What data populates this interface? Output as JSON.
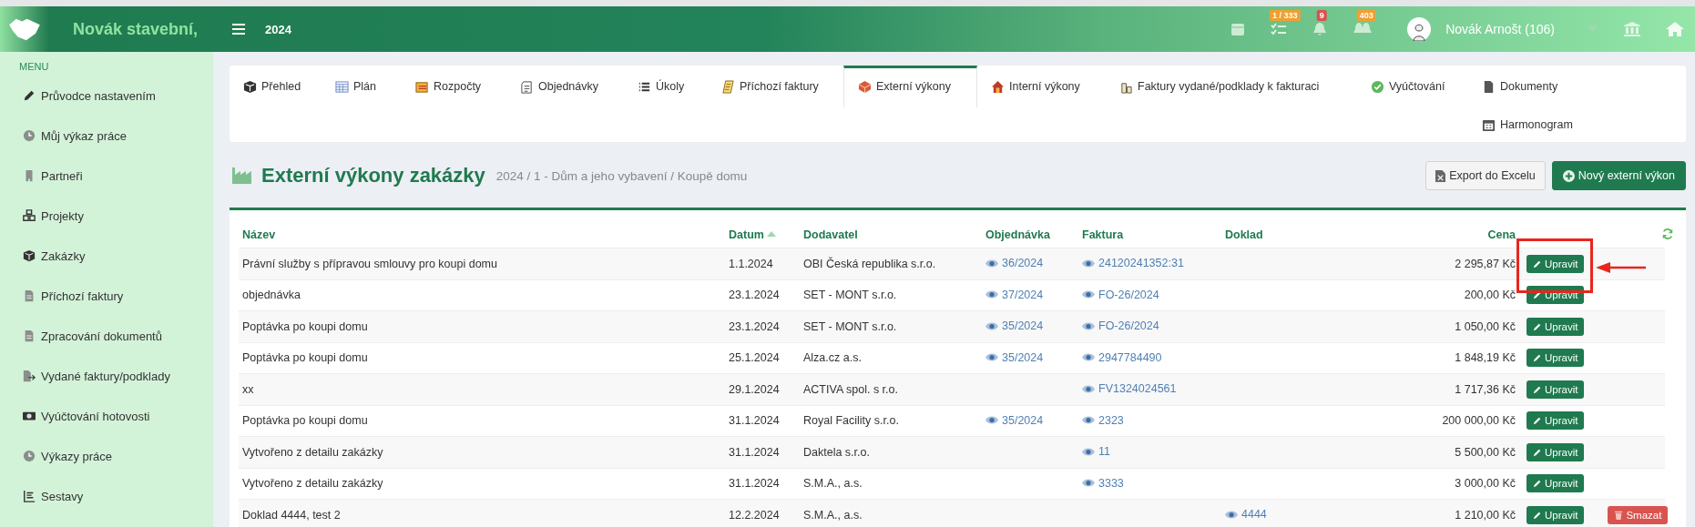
{
  "header": {
    "brand": "Novák stavební,",
    "year": "2024",
    "badges": [
      {
        "text": "1 / 333",
        "color": "#f0a030"
      },
      {
        "text": "9",
        "color": "#d9534f"
      },
      {
        "text": "403",
        "color": "#f0a030"
      }
    ],
    "user": "Novák Arnošt (106)"
  },
  "sidebar": {
    "heading": "MENU",
    "items": [
      {
        "label": "Průvodce nastavením"
      },
      {
        "label": "Můj výkaz práce"
      },
      {
        "label": "Partneři"
      },
      {
        "label": "Projekty"
      },
      {
        "label": "Zakázky"
      },
      {
        "label": "Příchozí faktury"
      },
      {
        "label": "Zpracování dokumentů"
      },
      {
        "label": "Vydané faktury/podklady"
      },
      {
        "label": "Vyúčtování hotovosti"
      },
      {
        "label": "Výkazy práce"
      },
      {
        "label": "Sestavy"
      }
    ]
  },
  "tabs": [
    {
      "label": "Přehled",
      "selected": false
    },
    {
      "label": "Plán",
      "selected": false
    },
    {
      "label": "Rozpočty",
      "selected": false
    },
    {
      "label": "Objednávky",
      "selected": false
    },
    {
      "label": "Úkoly",
      "selected": false
    },
    {
      "label": "Příchozí faktury",
      "selected": false
    },
    {
      "label": "Externí výkony",
      "selected": true
    },
    {
      "label": "Interní výkony",
      "selected": false
    },
    {
      "label": "Faktury vydané/podklady k fakturaci",
      "selected": false
    },
    {
      "label": "Vyúčtování",
      "selected": false
    },
    {
      "label": "Dokumenty",
      "selected": false
    },
    {
      "label": "Harmonogram",
      "selected": false
    }
  ],
  "page": {
    "title": "Externí výkony zakázky",
    "breadcrumb": "2024 / 1 - Dům a jeho vybavení / Koupě domu",
    "buttons": [
      {
        "label": "Export do Excelu",
        "kind": "export"
      },
      {
        "label": "Nový externí výkon",
        "kind": "add"
      }
    ]
  },
  "table": {
    "columns": [
      {
        "label": "Název",
        "sorted": false
      },
      {
        "label": "Datum",
        "sorted": true
      },
      {
        "label": "Dodavatel",
        "sorted": false
      },
      {
        "label": "Objednávka",
        "sorted": false
      },
      {
        "label": "Faktura",
        "sorted": false
      },
      {
        "label": "Doklad",
        "sorted": false
      },
      {
        "label": "Cena",
        "sorted": false
      }
    ],
    "rows": [
      {
        "name": "Právní služby s přípravou smlouvy pro koupi domu",
        "date": "1.1.2024",
        "supplier": "OBI Česká republika s.r.o.",
        "order": "36/2024",
        "invoice": "24120241352:31",
        "price": "2 295,87 Kč",
        "actions": [
          {
            "label": "Upravit",
            "kind": "edit"
          }
        ]
      },
      {
        "name": "objednávka",
        "date": "23.1.2024",
        "supplier": "SET - MONT s.r.o.",
        "order": "37/2024",
        "invoice": "FO-26/2024",
        "price": "200,00 Kč",
        "actions": [
          {
            "label": "Upravit",
            "kind": "edit"
          }
        ]
      },
      {
        "name": "Poptávka po koupi domu",
        "date": "23.1.2024",
        "supplier": "SET - MONT s.r.o.",
        "order": "35/2024",
        "invoice": "FO-26/2024",
        "price": "1 050,00 Kč",
        "actions": [
          {
            "label": "Upravit",
            "kind": "edit"
          }
        ]
      },
      {
        "name": "Poptávka po koupi domu",
        "date": "25.1.2024",
        "supplier": "Alza.cz a.s.",
        "order": "35/2024",
        "invoice": "2947784490",
        "price": "1 848,19 Kč",
        "actions": [
          {
            "label": "Upravit",
            "kind": "edit"
          }
        ]
      },
      {
        "name": "xx",
        "date": "29.1.2024",
        "supplier": "ACTIVA spol. s r.o.",
        "invoice": "FV1324024561",
        "price": "1 717,36 Kč",
        "actions": [
          {
            "label": "Upravit",
            "kind": "edit"
          }
        ]
      },
      {
        "name": "Poptávka po koupi domu",
        "date": "31.1.2024",
        "supplier": "Royal Facility s.r.o.",
        "order": "35/2024",
        "invoice": "2323",
        "price": "200 000,00 Kč",
        "actions": [
          {
            "label": "Upravit",
            "kind": "edit"
          }
        ]
      },
      {
        "name": "Vytvořeno z detailu zakázky",
        "date": "31.1.2024",
        "supplier": "Daktela s.r.o.",
        "invoice": "11",
        "price": "5 500,00 Kč",
        "actions": [
          {
            "label": "Upravit",
            "kind": "edit"
          }
        ]
      },
      {
        "name": "Vytvořeno z detailu zakázky",
        "date": "31.1.2024",
        "supplier": "S.M.A., a.s.",
        "invoice": "3333",
        "price": "3 000,00 Kč",
        "actions": [
          {
            "label": "Upravit",
            "kind": "edit"
          }
        ]
      },
      {
        "name": "Doklad 4444, test 2",
        "date": "12.2.2024",
        "supplier": "S.M.A., a.s.",
        "document": "4444",
        "price": "1 210,00 Kč",
        "actions": [
          {
            "label": "Upravit",
            "kind": "edit"
          },
          {
            "label": "Smazat",
            "kind": "delete"
          }
        ]
      }
    ]
  }
}
